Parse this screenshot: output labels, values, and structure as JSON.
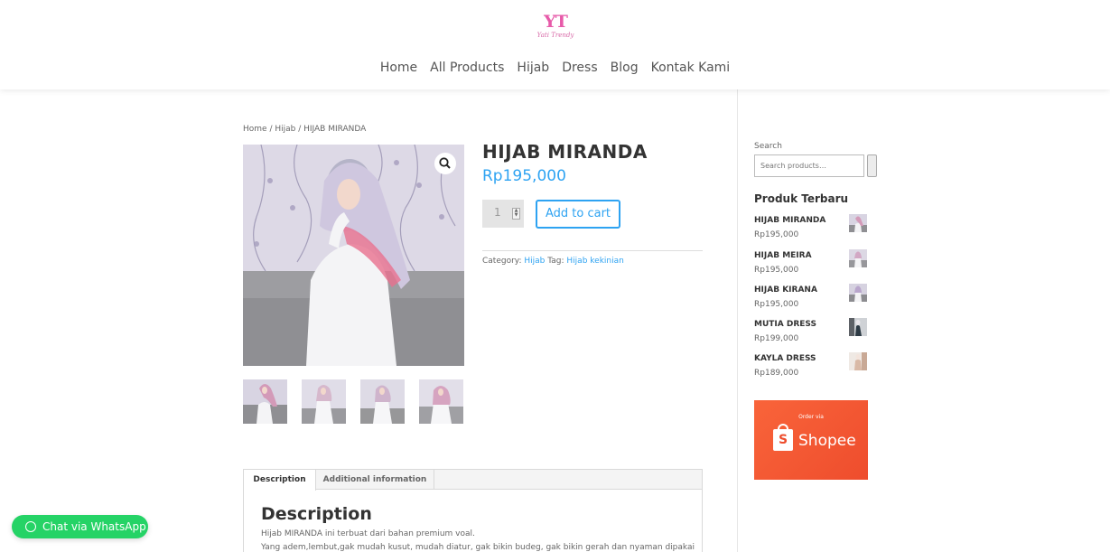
{
  "brand": {
    "logo_mark": "YT",
    "logo_sub": "Yati Trendy"
  },
  "nav": [
    "Home",
    "All Products",
    "Hijab",
    "Dress",
    "Blog",
    "Kontak Kami"
  ],
  "breadcrumb": {
    "text": "Home / Hijab / HIJAB MIRANDA"
  },
  "product": {
    "title": "HIJAB MIRANDA",
    "price": "Rp195,000",
    "quantity": "1",
    "add_to_cart": "Add to cart",
    "category_label": "Category:",
    "category": "Hijab",
    "tag_label": "Tag:",
    "tag": "Hijab kekinian",
    "zoom_icon": "magnifier-icon"
  },
  "tabs": [
    {
      "label": "Description",
      "active": true
    },
    {
      "label": "Additional information",
      "active": false
    }
  ],
  "description": {
    "title": "Description",
    "line1": "Hijab MIRANDA ini terbuat dari bahan premium voal.",
    "line2": "Yang adem,lembut,gak mudah kusut, mudah diatur, gak bikin budeg, gak bikin gerah dan nyaman dipakai"
  },
  "sidebar": {
    "search_label": "Search",
    "search_placeholder": "Search products…",
    "recent_title": "Produk Terbaru",
    "recent": [
      {
        "name": "HIJAB MIRANDA",
        "price": "Rp195,000"
      },
      {
        "name": "HIJAB MEIRA",
        "price": "Rp195,000"
      },
      {
        "name": "HIJAB KIRANA",
        "price": "Rp195,000"
      },
      {
        "name": "MUTIA DRESS",
        "price": "Rp199,000"
      },
      {
        "name": "KAYLA DRESS",
        "price": "Rp189,000"
      }
    ],
    "shopee": {
      "order_via": "Order via",
      "brand": "Shopee"
    }
  },
  "whatsapp": {
    "label": "Chat via WhatsApp"
  },
  "colors": {
    "accent": "#2ea3f2",
    "whatsapp": "#25d366",
    "shopee": "#ee4d2d",
    "logo": "#e75aa9"
  }
}
